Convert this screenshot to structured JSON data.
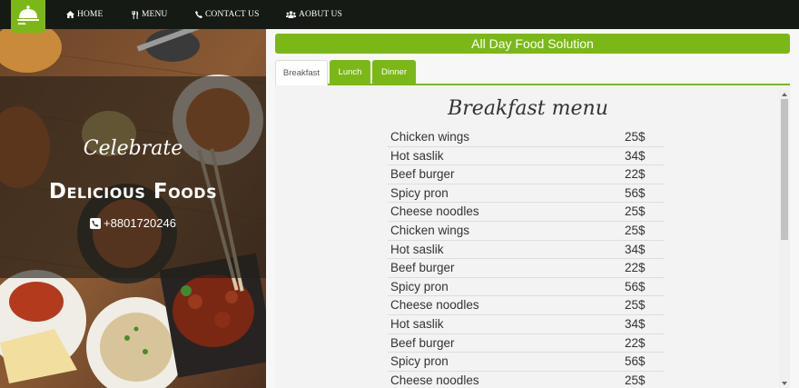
{
  "nav": {
    "items": [
      {
        "label": "HOME",
        "icon": "home-icon"
      },
      {
        "label": "MENU",
        "icon": "cutlery-icon"
      },
      {
        "label": "CONTACT US",
        "icon": "phone-icon"
      },
      {
        "label": "AOBUT US",
        "icon": "users-icon"
      }
    ]
  },
  "hero": {
    "celebrate": "Celebrate",
    "title": "Delicious Foods",
    "phone": "+8801720246"
  },
  "banner": "All Day Food Solution",
  "tabs": [
    {
      "label": "Breakfast",
      "active": true
    },
    {
      "label": "Lunch",
      "active": false
    },
    {
      "label": "Dinner",
      "active": false
    }
  ],
  "menu": {
    "title": "Breakfast menu",
    "items": [
      {
        "name": "Chicken wings",
        "price": "25$"
      },
      {
        "name": "Hot saslik",
        "price": "34$"
      },
      {
        "name": "Beef burger",
        "price": "22$"
      },
      {
        "name": "Spicy pron",
        "price": "56$"
      },
      {
        "name": "Cheese noodles",
        "price": "25$"
      },
      {
        "name": "Chicken wings",
        "price": "25$"
      },
      {
        "name": "Hot saslik",
        "price": "34$"
      },
      {
        "name": "Beef burger",
        "price": "22$"
      },
      {
        "name": "Spicy pron",
        "price": "56$"
      },
      {
        "name": "Cheese noodles",
        "price": "25$"
      },
      {
        "name": "Hot saslik",
        "price": "34$"
      },
      {
        "name": "Beef burger",
        "price": "22$"
      },
      {
        "name": "Spicy pron",
        "price": "56$"
      },
      {
        "name": "Cheese noodles",
        "price": "25$"
      }
    ]
  },
  "colors": {
    "accent": "#7bb817",
    "topbar": "#161a14"
  }
}
